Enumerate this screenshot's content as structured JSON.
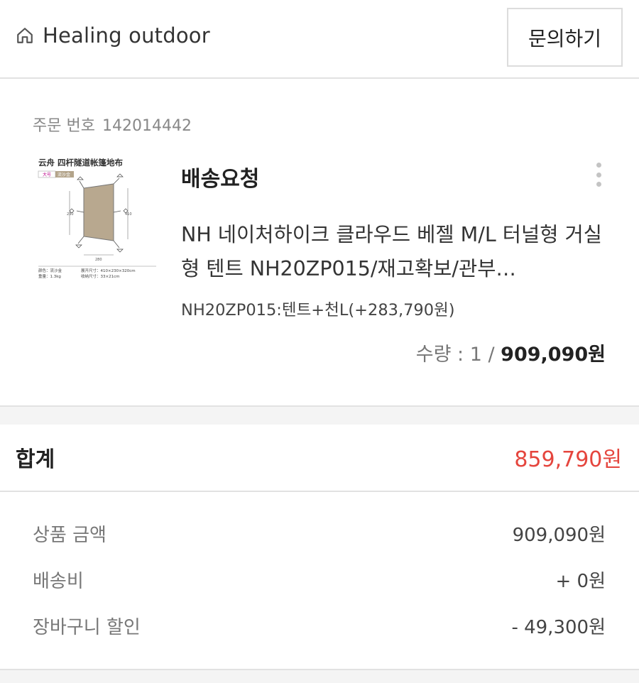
{
  "header": {
    "store_name": "Healing outdoor",
    "inquiry_label": "문의하기"
  },
  "order": {
    "number_label": "주문 번호",
    "number": "142014442",
    "status": "배송요청",
    "product_name": "NH 네이처하이크 클라우드 베젤 M/L 터널형 거실형 텐트 NH20ZP015/재고확보/관부…",
    "option": "NH20ZP015:텐트+천L(+283,790원)",
    "quantity_text": "수량 : 1 / ",
    "price": "909,090원",
    "thumbnail": {
      "title": "云舟 四杆隧道帐篷地布",
      "tag1": "大号",
      "tag2": "流沙金",
      "dim_bottom": "280",
      "dim_left": "230",
      "dim_right": "410",
      "spec_color_label": "颜色：流沙金",
      "spec_size_label": "展开尺寸：410×230×320cm",
      "spec_weight_label": "重量：1.3kg",
      "spec_pack_label": "收纳尺寸：33×21cm"
    }
  },
  "total": {
    "label": "합계",
    "value": "859,790원"
  },
  "breakdown": [
    {
      "label": "상품 금액",
      "value": "909,090원"
    },
    {
      "label": "배송비",
      "value": "+ 0원"
    },
    {
      "label": "장바구니 할인",
      "value": "- 49,300원"
    }
  ],
  "colors": {
    "accent_red": "#e5453d",
    "divider": "#e2e2e2",
    "band": "#f4f4f4"
  },
  "icons": {
    "home": "home-icon",
    "more": "more-vertical-icon"
  }
}
